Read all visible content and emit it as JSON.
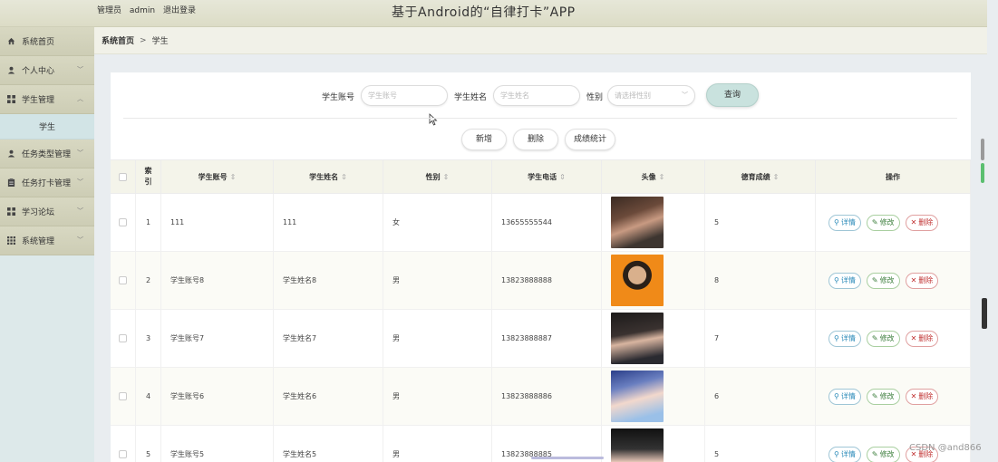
{
  "header": {
    "role": "管理员",
    "username": "admin",
    "logout": "退出登录",
    "title": "基于Android的“自律打卡”APP"
  },
  "sidebar": {
    "items": [
      {
        "label": "系统首页",
        "icon": "home-icon",
        "expandable": false
      },
      {
        "label": "个人中心",
        "icon": "user-icon",
        "expandable": true
      },
      {
        "label": "学生管理",
        "icon": "grid-icon",
        "expandable": true,
        "expanded": true
      },
      {
        "label": "任务类型管理",
        "icon": "user-icon",
        "expandable": true
      },
      {
        "label": "任务打卡管理",
        "icon": "clipboard-icon",
        "expandable": true
      },
      {
        "label": "学习论坛",
        "icon": "grid-icon",
        "expandable": true
      },
      {
        "label": "系统管理",
        "icon": "grid-icon",
        "expandable": true
      }
    ],
    "submenu": {
      "label": "学生"
    }
  },
  "breadcrumb": {
    "home": "系统首页",
    "separator": ">",
    "current": "学生"
  },
  "search": {
    "account_label": "学生账号",
    "account_placeholder": "学生账号",
    "name_label": "学生姓名",
    "name_placeholder": "学生姓名",
    "sex_label": "性别",
    "sex_placeholder": "请选择性别",
    "query_label": "查询"
  },
  "actions": {
    "add": "新增",
    "delete": "删除",
    "stats": "成绩统计"
  },
  "table": {
    "columns": [
      "索引",
      "学生账号",
      "学生姓名",
      "性别",
      "学生电话",
      "头像",
      "德育成绩",
      "操作"
    ],
    "index_header_line1": "索",
    "index_header_line2": "引",
    "rows": [
      {
        "index": "1",
        "account": "111",
        "name": "111",
        "sex": "女",
        "phone": "13655555544",
        "score": "5"
      },
      {
        "index": "2",
        "account": "学生账号8",
        "name": "学生姓名8",
        "sex": "男",
        "phone": "13823888888",
        "score": "8"
      },
      {
        "index": "3",
        "account": "学生账号7",
        "name": "学生姓名7",
        "sex": "男",
        "phone": "13823888887",
        "score": "7"
      },
      {
        "index": "4",
        "account": "学生账号6",
        "name": "学生姓名6",
        "sex": "男",
        "phone": "13823888886",
        "score": "6"
      },
      {
        "index": "5",
        "account": "学生账号5",
        "name": "学生姓名5",
        "sex": "男",
        "phone": "13823888885",
        "score": "5"
      }
    ],
    "op_detail": "详情",
    "op_edit": "修改",
    "op_delete": "删除"
  },
  "watermark": "CSDN @and866",
  "colors": {
    "topbar": "#dcdcc6",
    "sidebar": "#dde9ea",
    "query_button": "#c9e2de",
    "detail": "#2a8ab8",
    "edit": "#3a7d3a",
    "delete": "#c03030"
  }
}
